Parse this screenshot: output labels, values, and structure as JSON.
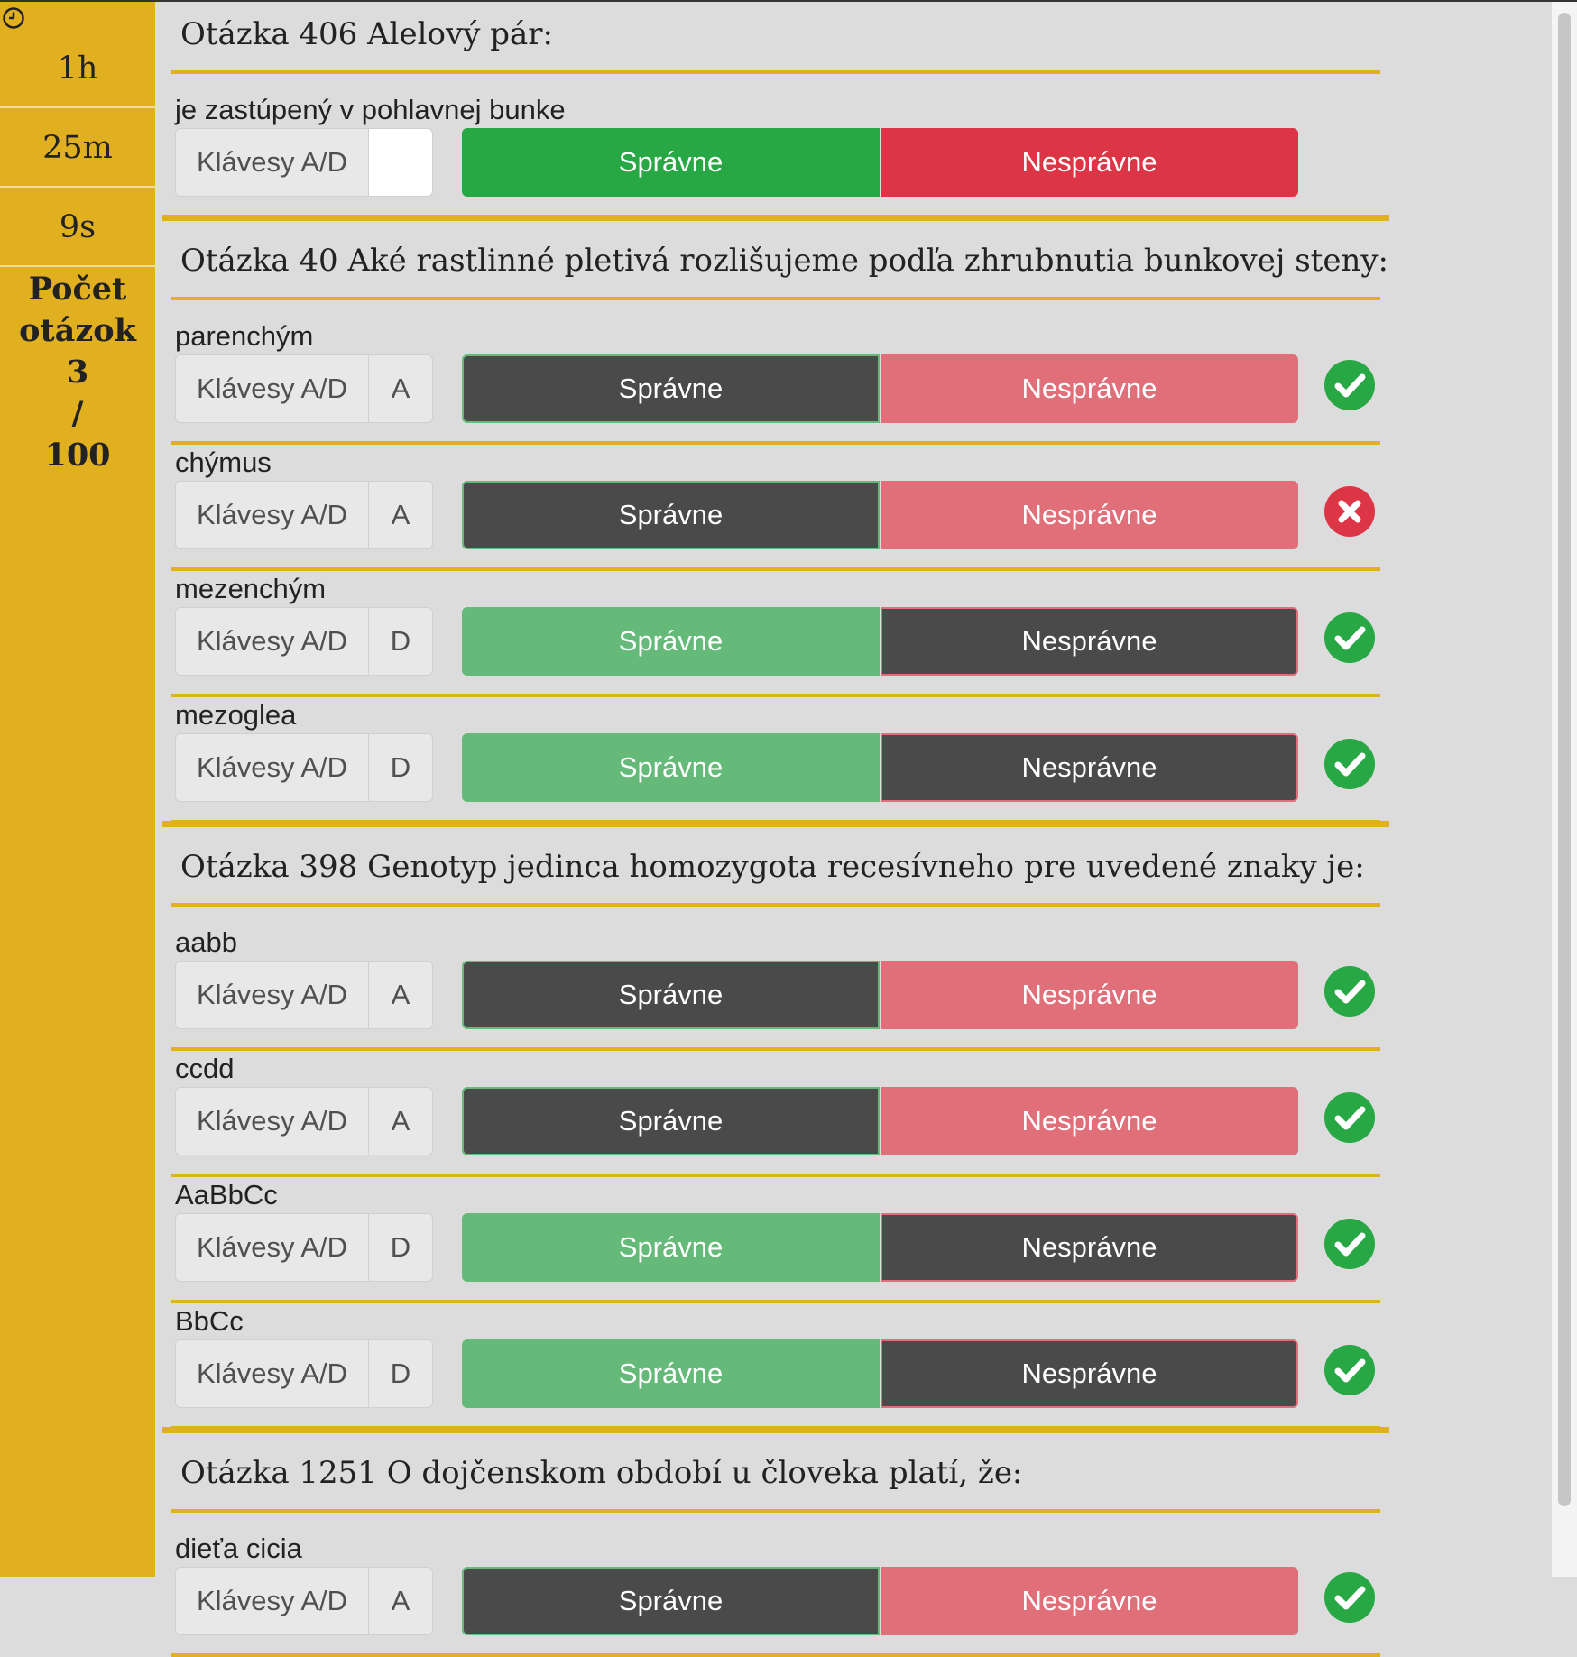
{
  "sidebar": {
    "hours": "1h",
    "minutes": "25m",
    "seconds": "9s",
    "count_label_1": "Počet",
    "count_label_2": "otázok",
    "count_current": "3",
    "count_sep": "/",
    "count_total": "100"
  },
  "common": {
    "key_hint": "Klávesy A/D",
    "correct_label": "Správne",
    "wrong_label": "Nesprávne"
  },
  "colors": {
    "sidebar_bg": "#e0b021",
    "correct_green": "#28a745",
    "wrong_red": "#dc3545",
    "status_ok": "#28a745",
    "status_bad": "#dc3545"
  },
  "questions": [
    {
      "title": "Otázka 406 Alelový pár:",
      "answers": [
        {
          "text": "je zastúpený v pohlavnej bunke",
          "key": "",
          "selected": "none",
          "status": "none"
        }
      ]
    },
    {
      "title": "Otázka 40 Aké rastlinné pletivá rozlišujeme podľa zhrubnutia bunkovej steny:",
      "answers": [
        {
          "text": "parenchým",
          "key": "A",
          "selected": "correct",
          "status": "check-icon"
        },
        {
          "text": "chýmus",
          "key": "A",
          "selected": "correct",
          "status": "cross-icon"
        },
        {
          "text": "mezenchým",
          "key": "D",
          "selected": "wrong",
          "status": "check-icon"
        },
        {
          "text": "mezoglea",
          "key": "D",
          "selected": "wrong",
          "status": "check-icon"
        }
      ]
    },
    {
      "title": "Otázka 398 Genotyp jedinca homozygota recesívneho pre uvedené znaky je:",
      "answers": [
        {
          "text": "aabb",
          "key": "A",
          "selected": "correct",
          "status": "check-icon"
        },
        {
          "text": "ccdd",
          "key": "A",
          "selected": "correct",
          "status": "check-icon"
        },
        {
          "text": "AaBbCc",
          "key": "D",
          "selected": "wrong",
          "status": "check-icon"
        },
        {
          "text": "BbCc",
          "key": "D",
          "selected": "wrong",
          "status": "check-icon"
        }
      ]
    },
    {
      "title": "Otázka 1251 O dojčenskom období u človeka platí, že:",
      "answers": [
        {
          "text": "dieťa cicia",
          "key": "A",
          "selected": "correct",
          "status": "check-icon"
        }
      ]
    }
  ]
}
